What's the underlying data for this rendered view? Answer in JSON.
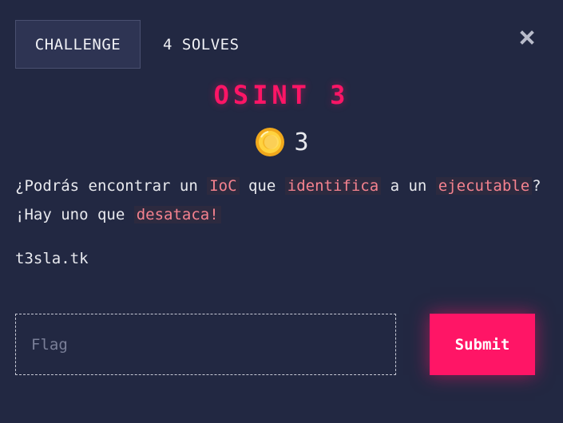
{
  "tabs": {
    "challenge_label": "CHALLENGE",
    "solves_label": "4 SOLVES"
  },
  "close_icon": "close-icon",
  "challenge": {
    "title": "OSINT 3",
    "points_icon": "coin-icon",
    "points": "3",
    "description": [
      {
        "text": "¿Podrás encontrar un ",
        "code": false
      },
      {
        "text": "IoC",
        "code": true
      },
      {
        "text": " que ",
        "code": false
      },
      {
        "text": "identifica",
        "code": true
      },
      {
        "text": " a un ",
        "code": false
      },
      {
        "text": "ejecutable",
        "code": true
      },
      {
        "text": "? ¡Hay uno que ",
        "code": false
      },
      {
        "text": "desataca!",
        "code": true
      }
    ],
    "link": "t3sla.tk"
  },
  "form": {
    "flag_placeholder": "Flag",
    "flag_value": "",
    "submit_label": "Submit"
  },
  "colors": {
    "background": "#222842",
    "accent": "#ff1566",
    "code_text": "#f5828f",
    "code_bg": "#2d2a3f"
  }
}
